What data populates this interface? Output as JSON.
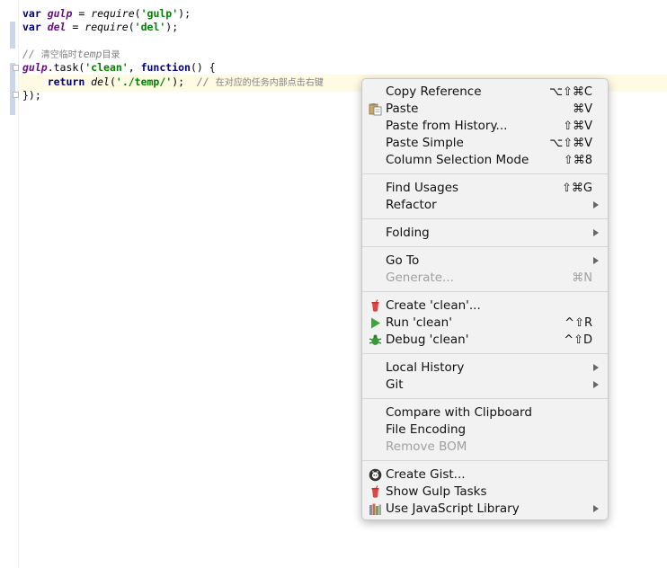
{
  "editor": {
    "lines": [
      {
        "p1": "var ",
        "p2": "gulp",
        "p3": " = ",
        "p4": "require",
        "p5": "(",
        "p6": "'gulp'",
        "p7": ");"
      },
      {
        "p1": "var ",
        "p2": "del",
        "p3": " = ",
        "p4": "require",
        "p5": "(",
        "p6": "'del'",
        "p7": ");"
      }
    ],
    "comment_prefix": "// ",
    "comment_text_a": "清空临时",
    "comment_word": "temp",
    "comment_text_b": "目录",
    "task_obj": "gulp",
    "task_method": ".task(",
    "task_name": "'clean'",
    "task_rest_a": ", ",
    "task_fn_kw": "function",
    "task_rest_b": "() {",
    "return_kw": "return ",
    "return_fn": "del",
    "return_open": "(",
    "return_arg": "'./temp/'",
    "return_close": ");",
    "inline_comment_prefix": "// ",
    "inline_comment_text": "在对应的任务内部点击右键",
    "closing": "});"
  },
  "menu": {
    "copy_reference": {
      "label": "Copy Reference",
      "shortcut": "⌥⇧⌘C"
    },
    "paste": {
      "label": "Paste",
      "shortcut": "⌘V",
      "icon": "clipboard-paste-icon"
    },
    "paste_history": {
      "label": "Paste from History...",
      "shortcut": "⇧⌘V"
    },
    "paste_simple": {
      "label": "Paste Simple",
      "shortcut": "⌥⇧⌘V"
    },
    "column_selection": {
      "label": "Column Selection Mode",
      "shortcut": "⇧⌘8"
    },
    "find_usages": {
      "label": "Find Usages",
      "shortcut": "⇧⌘G"
    },
    "refactor": {
      "label": "Refactor"
    },
    "folding": {
      "label": "Folding"
    },
    "go_to": {
      "label": "Go To"
    },
    "generate": {
      "label": "Generate...",
      "shortcut": "⌘N"
    },
    "create_clean": {
      "label": "Create 'clean'...",
      "icon": "gulp-icon"
    },
    "run_clean": {
      "label": "Run 'clean'",
      "shortcut": "^⇧R",
      "icon": "run-icon"
    },
    "debug_clean": {
      "label": "Debug 'clean'",
      "shortcut": "^⇧D",
      "icon": "debug-bug-icon"
    },
    "local_history": {
      "label": "Local History"
    },
    "git": {
      "label": "Git"
    },
    "compare_clipboard": {
      "label": "Compare with Clipboard"
    },
    "file_encoding": {
      "label": "File Encoding"
    },
    "remove_bom": {
      "label": "Remove BOM"
    },
    "create_gist": {
      "label": "Create Gist...",
      "icon": "github-icon"
    },
    "show_gulp_tasks": {
      "label": "Show Gulp Tasks",
      "icon": "gulp-icon"
    },
    "use_js_library": {
      "label": "Use JavaScript Library",
      "icon": "js-library-icon"
    }
  },
  "colors": {
    "keyword": "#000080",
    "variable": "#660e7a",
    "string": "#008000",
    "comment": "#808080",
    "caret_line": "#fffae3",
    "menu_bg": "#f2f2f2",
    "run_green": "#3fa63f",
    "gulp_red": "#e04545"
  }
}
